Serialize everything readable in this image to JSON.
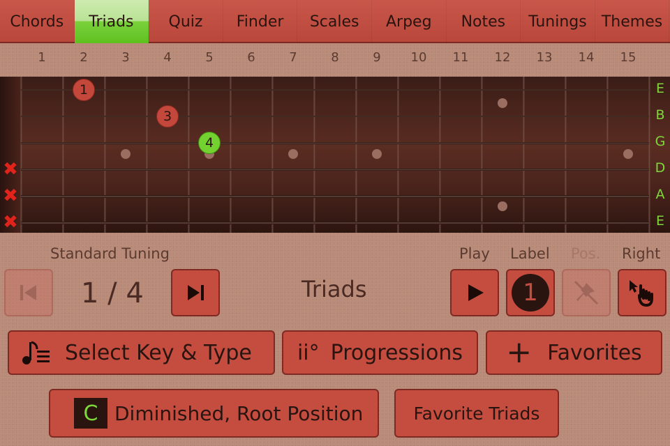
{
  "tabs": [
    {
      "label": "Chords",
      "active": false
    },
    {
      "label": "Triads",
      "active": true
    },
    {
      "label": "Quiz",
      "active": false
    },
    {
      "label": "Finder",
      "active": false
    },
    {
      "label": "Scales",
      "active": false
    },
    {
      "label": "Arpeg",
      "active": false
    },
    {
      "label": "Notes",
      "active": false
    },
    {
      "label": "Tunings",
      "active": false
    },
    {
      "label": "Themes",
      "active": false
    }
  ],
  "fret_numbers": [
    "1",
    "2",
    "3",
    "4",
    "5",
    "6",
    "7",
    "8",
    "9",
    "10",
    "11",
    "12",
    "13",
    "14",
    "15"
  ],
  "string_names": [
    "E",
    "B",
    "G",
    "D",
    "A",
    "E"
  ],
  "muted_strings": [
    "D",
    "A",
    "E"
  ],
  "notes": [
    {
      "label": "1",
      "string": 1,
      "fret": 2,
      "color": "red"
    },
    {
      "label": "3",
      "string": 2,
      "fret": 4,
      "color": "red"
    },
    {
      "label": "4",
      "string": 3,
      "fret": 5,
      "color": "green"
    }
  ],
  "colors": {
    "accent_green": "#7fd83a",
    "button_red": "#c44d40",
    "mute_red": "#e0241c"
  },
  "tuning_label": "Standard Tuning",
  "counter": "1 / 4",
  "mode_title": "Triads",
  "controls": {
    "play_label": "Play",
    "label_label": "Label",
    "pos_label": "Pos.",
    "right_label": "Right",
    "label_value": "1"
  },
  "buttons": {
    "select_key": "Select Key & Type",
    "progressions_symbol": "ii°",
    "progressions": "Progressions",
    "favorites": "Favorites",
    "key": "C",
    "chord_name": "Diminished, Root Position",
    "favorite_triads": "Favorite Triads"
  }
}
